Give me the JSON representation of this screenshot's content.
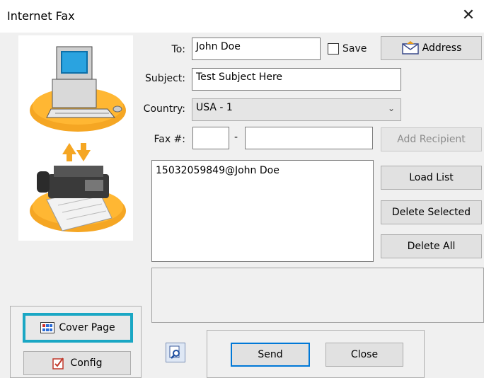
{
  "window": {
    "title": "Internet Fax"
  },
  "form": {
    "to_label": "To:",
    "to_value": "John Doe",
    "save_label": "Save",
    "subject_label": "Subject:",
    "subject_value": "Test Subject Here",
    "country_label": "Country:",
    "country_value": "USA - 1",
    "fax_label": "Fax #:",
    "fax_area_value": "",
    "fax_dash": "-",
    "fax_number_value": ""
  },
  "buttons": {
    "address": "Address",
    "add_recipient": "Add Recipient",
    "load_list": "Load List",
    "delete_selected": "Delete Selected",
    "delete_all": "Delete All",
    "cover_page": "Cover Page",
    "config": "Config",
    "send": "Send",
    "close": "Close"
  },
  "recipients": [
    "15032059849@John Doe"
  ],
  "colors": {
    "highlight": "#1aa7c4",
    "accent": "#0078d7",
    "orange": "#f5a623"
  }
}
